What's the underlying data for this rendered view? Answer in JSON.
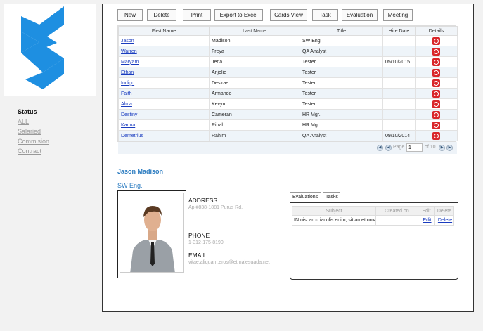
{
  "sidebar": {
    "status_title": "Status",
    "links": [
      "ALL",
      "Salaried",
      "Commision",
      "Contract"
    ]
  },
  "toolbar": {
    "buttons": [
      "New",
      "Delete",
      "Print",
      "Export to Excel",
      "Cards View",
      "Task",
      "Evaluation",
      "Meeting"
    ]
  },
  "grid": {
    "columns": [
      "First Name",
      "Last Name",
      "Title",
      "Hire Date",
      "Details"
    ],
    "rows": [
      [
        "Jason",
        "Madison",
        "SW Eng.",
        ""
      ],
      [
        "Warren",
        "Freya",
        "QA Analyst",
        ""
      ],
      [
        "Maryam",
        "Jena",
        "Tester",
        "05/10/2015"
      ],
      [
        "Ethan",
        "Anjolie",
        "Tester",
        ""
      ],
      [
        "Indigo",
        "Desirae",
        "Tester",
        ""
      ],
      [
        "Faith",
        "Armando",
        "Tester",
        ""
      ],
      [
        "Alma",
        "Kevyn",
        "Tester",
        ""
      ],
      [
        "Destiny",
        "Cameran",
        "HR Mgr.",
        ""
      ],
      [
        "Karina",
        "Rinah",
        "HR Mgr.",
        ""
      ],
      [
        "Demetrius",
        "Rahim",
        "QA Analyst",
        "09/10/2014"
      ]
    ],
    "pager": {
      "page_label": "Page",
      "page_value": "1",
      "of_label": "of 10"
    }
  },
  "employee": {
    "name": "Jason Madison",
    "title": "SW Eng.",
    "address_label": "ADDRESS",
    "address": "Ap #838-1881 Purus Rd.",
    "phone_label": "PHONE",
    "phone": "1-312-175-8190",
    "email_label": "EMAIL",
    "email": "vitae.aliquam.eros@etmalesuada.net"
  },
  "evaluations": {
    "tabs": [
      "Evaluations",
      "Tasks"
    ],
    "columns": [
      "Subject",
      "Created on",
      "Edit",
      "Delete"
    ],
    "rows": [
      {
        "subject": "IN nisl arcu iaculis enim, sit amet ornare",
        "created": "",
        "edit": "Edit",
        "delete": "Delete"
      }
    ]
  },
  "colors": {
    "accent": "#2a7bc0",
    "logo": "#1e8fe1",
    "details_icon": "#d9262a",
    "link": "#1a3cbf"
  }
}
